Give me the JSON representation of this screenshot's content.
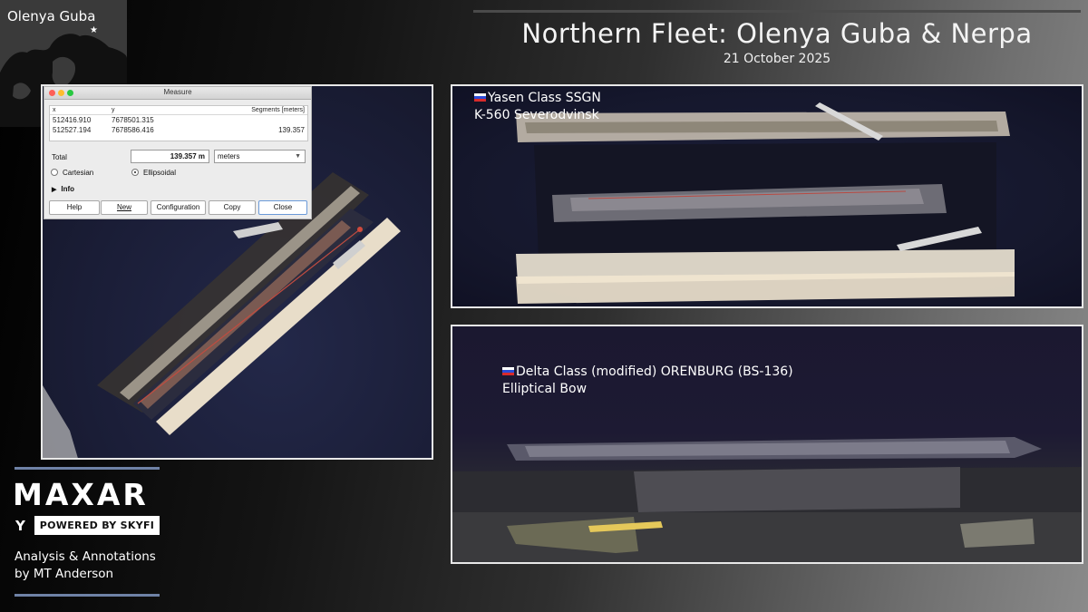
{
  "header": {
    "title": "Northern Fleet: Olenya Guba & Nerpa",
    "date": "21 October 2025"
  },
  "locator": {
    "label": "Olenya Guba"
  },
  "measure_dialog": {
    "title": "Measure",
    "columns": [
      "x",
      "y",
      "Segments [meters]"
    ],
    "rows": [
      {
        "x": "512416.910",
        "y": "7678501.315",
        "segment": ""
      },
      {
        "x": "512527.194",
        "y": "7678586.416",
        "segment": "139.357"
      }
    ],
    "total_label": "Total",
    "total_value": "139.357 m",
    "unit": "meters",
    "radio_cartesian": "Cartesian",
    "radio_ellipsoidal": "Ellipsoidal",
    "selected_mode": "Ellipsoidal",
    "info_label": "Info",
    "buttons": {
      "help": "Help",
      "new": "New",
      "configuration": "Configuration",
      "copy": "Copy",
      "close": "Close"
    }
  },
  "panels": {
    "top_right": {
      "line1": "Yasen Class SSGN",
      "line2": "K-560 Severodvinsk"
    },
    "bottom_right": {
      "line1": "Delta Class (modified) ORENBURG (BS-136)",
      "line2": "Elliptical Bow"
    }
  },
  "branding": {
    "logo": "MAXAR",
    "powered_by": "POWERED BY SKYFI",
    "skyfi_mark": "Y",
    "credit_line1": "Analysis & Annotations",
    "credit_line2": "by MT Anderson"
  },
  "colors": {
    "accent_rule": "#6f82a6",
    "flag_white": "#ffffff",
    "flag_blue": "#2b4bd8",
    "flag_red": "#d82b2b"
  }
}
